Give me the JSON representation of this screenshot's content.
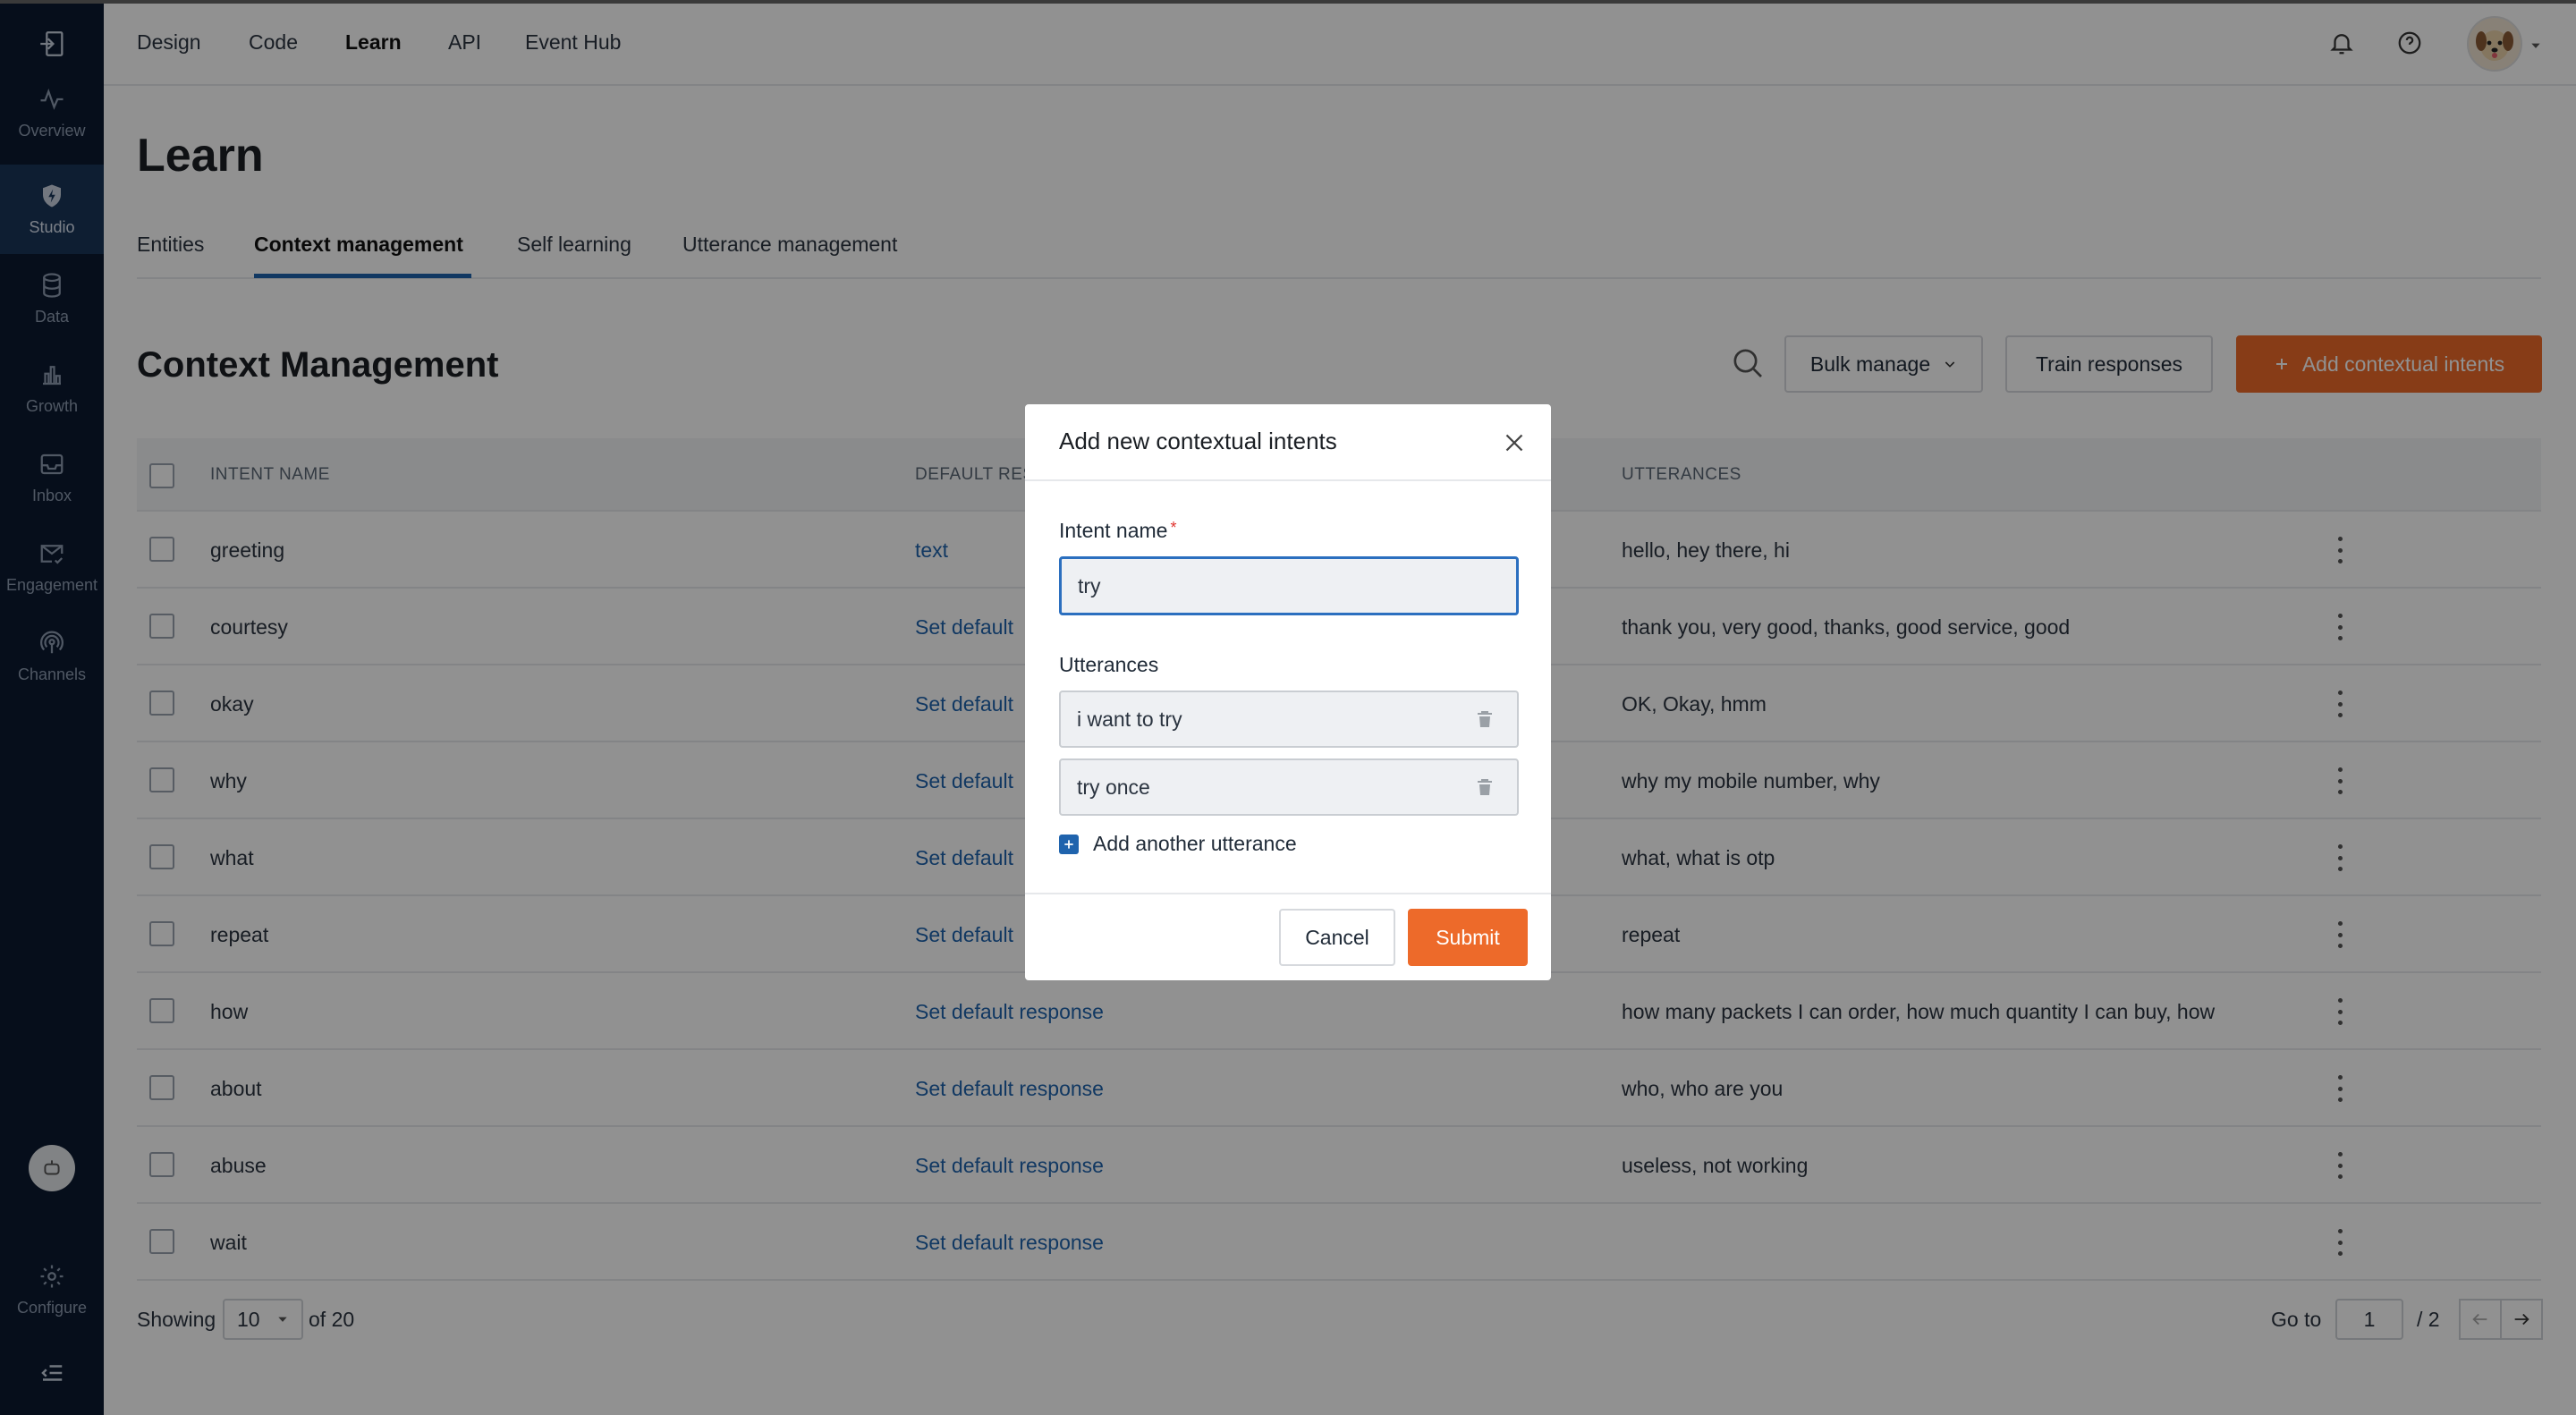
{
  "sidebar": {
    "items": [
      {
        "label": "Overview",
        "icon": "pulse-icon"
      },
      {
        "label": "Studio",
        "icon": "shield-bolt-icon"
      },
      {
        "label": "Data",
        "icon": "database-icon"
      },
      {
        "label": "Growth",
        "icon": "bar-chart-icon"
      },
      {
        "label": "Inbox",
        "icon": "inbox-icon"
      },
      {
        "label": "Engagement",
        "icon": "mail-check-icon"
      },
      {
        "label": "Channels",
        "icon": "broadcast-icon"
      },
      {
        "label": "Configure",
        "icon": "gear-icon"
      }
    ]
  },
  "topnav": {
    "items": [
      {
        "label": "Design"
      },
      {
        "label": "Code"
      },
      {
        "label": "Learn"
      },
      {
        "label": "API"
      },
      {
        "label": "Event Hub"
      }
    ]
  },
  "page": {
    "title": "Learn",
    "tabs": [
      {
        "label": "Entities"
      },
      {
        "label": "Context management"
      },
      {
        "label": "Self learning"
      },
      {
        "label": "Utterance management"
      }
    ]
  },
  "section": {
    "title": "Context Management",
    "bulk_manage": "Bulk manage",
    "train_responses": "Train responses",
    "add_intents": "Add contextual intents"
  },
  "table": {
    "headers": {
      "intent_name": "INTENT NAME",
      "default_response": "DEFAULT RES",
      "utterances": "UTTERANCES"
    },
    "rows": [
      {
        "intent": "greeting",
        "response": "text",
        "utterances": "hello, hey there, hi"
      },
      {
        "intent": "courtesy",
        "response": "Set default",
        "utterances": "thank you, very good, thanks, good service, good"
      },
      {
        "intent": "okay",
        "response": "Set default",
        "utterances": "OK, Okay, hmm"
      },
      {
        "intent": "why",
        "response": "Set default",
        "utterances": "why my mobile number, why"
      },
      {
        "intent": "what",
        "response": "Set default",
        "utterances": "what, what is otp"
      },
      {
        "intent": "repeat",
        "response": "Set default",
        "utterances": "repeat"
      },
      {
        "intent": "how",
        "response": "Set default response",
        "utterances": "how many packets I can order, how much quantity I can buy, how"
      },
      {
        "intent": "about",
        "response": "Set default response",
        "utterances": "who, who are you"
      },
      {
        "intent": "abuse",
        "response": "Set default response",
        "utterances": "useless, not working"
      },
      {
        "intent": "wait",
        "response": "Set default response",
        "utterances": ""
      }
    ]
  },
  "pagination": {
    "showing": "Showing",
    "page_size": "10",
    "of_total": "of 20",
    "goto": "Go to",
    "current_page": "1",
    "total_pages": "/ 2"
  },
  "modal": {
    "title": "Add new contextual intents",
    "intent_label": "Intent name",
    "required_mark": "*",
    "intent_value": "try",
    "utterances_label": "Utterances",
    "utterances": [
      "i want to try",
      "try once"
    ],
    "add_utterance": "Add another utterance",
    "cancel": "Cancel",
    "submit": "Submit"
  },
  "colors": {
    "accent": "#ed6a2a",
    "link": "#1f63ad",
    "sidebar": "#0b1a30"
  }
}
